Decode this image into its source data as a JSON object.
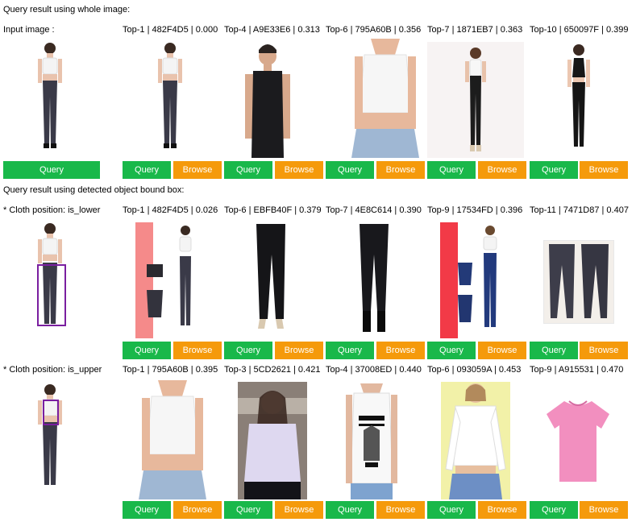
{
  "sections": [
    {
      "title": "Query result using whole image:",
      "query_label": "Input image :",
      "results": [
        {
          "label": "Top-1 | 482F4D5 | 0.000",
          "image": "model-white-top-dark-jeans"
        },
        {
          "label": "Top-4 | A9E33E6 | 0.313",
          "image": "man-black-tank-top"
        },
        {
          "label": "Top-6 | 795A60B | 0.356",
          "image": "white-crop-top-closeup"
        },
        {
          "label": "Top-7 | 1871EB7 | 0.363",
          "image": "model-white-top-black-pants"
        },
        {
          "label": "Top-10 | 650097F | 0.399",
          "image": "model-black-halter-black-pants"
        }
      ]
    },
    {
      "title": "Query result using detected object bound box:",
      "query_label": "* Cloth position: is_lower",
      "results": [
        {
          "label": "Top-1 | 482F4D5 | 0.026",
          "image": "collage-pink-dark-jeans"
        },
        {
          "label": "Top-6 | EBFB40F | 0.379",
          "image": "black-skinny-jeans"
        },
        {
          "label": "Top-7 | 4E8C614 | 0.390",
          "image": "black-jeans-boots"
        },
        {
          "label": "Top-9 | 17534FD | 0.396",
          "image": "collage-red-blue-jeans"
        },
        {
          "label": "Top-11 | 7471D87 | 0.407",
          "image": "two-dark-jeans"
        }
      ]
    },
    {
      "title": "",
      "query_label": "* Cloth position: is_upper",
      "results": [
        {
          "label": "Top-1 | 795A60B | 0.395",
          "image": "white-crop-top-closeup"
        },
        {
          "label": "Top-3 | 5CD2621 | 0.421",
          "image": "woman-lavender-shirt"
        },
        {
          "label": "Top-4 | 37008ED | 0.440",
          "image": "graphic-tank-top"
        },
        {
          "label": "Top-6 | 093059A | 0.453",
          "image": "white-long-sleeve-top"
        },
        {
          "label": "Top-9 | A915531 | 0.470",
          "image": "pink-tshirt"
        }
      ]
    }
  ],
  "buttons": {
    "query": "Query",
    "browse": "Browse"
  },
  "colors": {
    "query": "#19b84a",
    "browse": "#f59a0b",
    "bbox": "#7a1fa0"
  }
}
